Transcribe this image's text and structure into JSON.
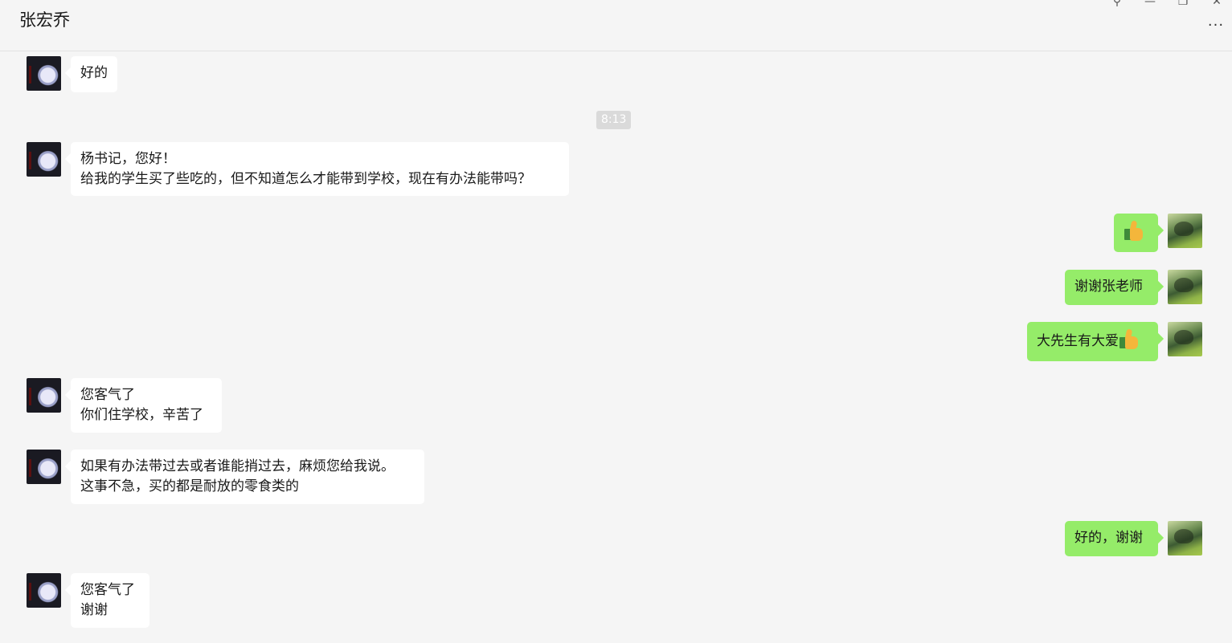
{
  "header": {
    "title": "张宏乔",
    "pin_glyph": "⚲",
    "minimize_glyph": "—",
    "restore_glyph": "❐",
    "close_glyph": "✕",
    "more_glyph": "···"
  },
  "timestamp": "8:13",
  "messages": [
    {
      "side": "left",
      "lines": [
        "好的"
      ]
    },
    {
      "side": "left",
      "lines": [
        "杨书记，您好！",
        "给我的学生买了些吃的，但不知道怎么才能带到学校，现在有办法能带吗？"
      ]
    },
    {
      "side": "right",
      "lines": [],
      "emoji": "thumbs-up"
    },
    {
      "side": "right",
      "lines": [
        "谢谢张老师"
      ]
    },
    {
      "side": "right",
      "lines": [
        "大先生有大爱"
      ],
      "emoji": "thumbs-up"
    },
    {
      "side": "left",
      "lines": [
        "您客气了",
        "你们住学校，辛苦了"
      ]
    },
    {
      "side": "left",
      "lines": [
        "如果有办法带过去或者谁能捎过去，麻烦您给我说。",
        "这事不急，买的都是耐放的零食类的"
      ]
    },
    {
      "side": "right",
      "lines": [
        "好的，谢谢"
      ]
    },
    {
      "side": "left",
      "lines": [
        "您客气了",
        "谢谢"
      ]
    }
  ],
  "colors": {
    "background": "#f5f5f5",
    "bubble_left": "#ffffff",
    "bubble_right": "#95ec69",
    "timestamp_bg": "#dadada"
  }
}
